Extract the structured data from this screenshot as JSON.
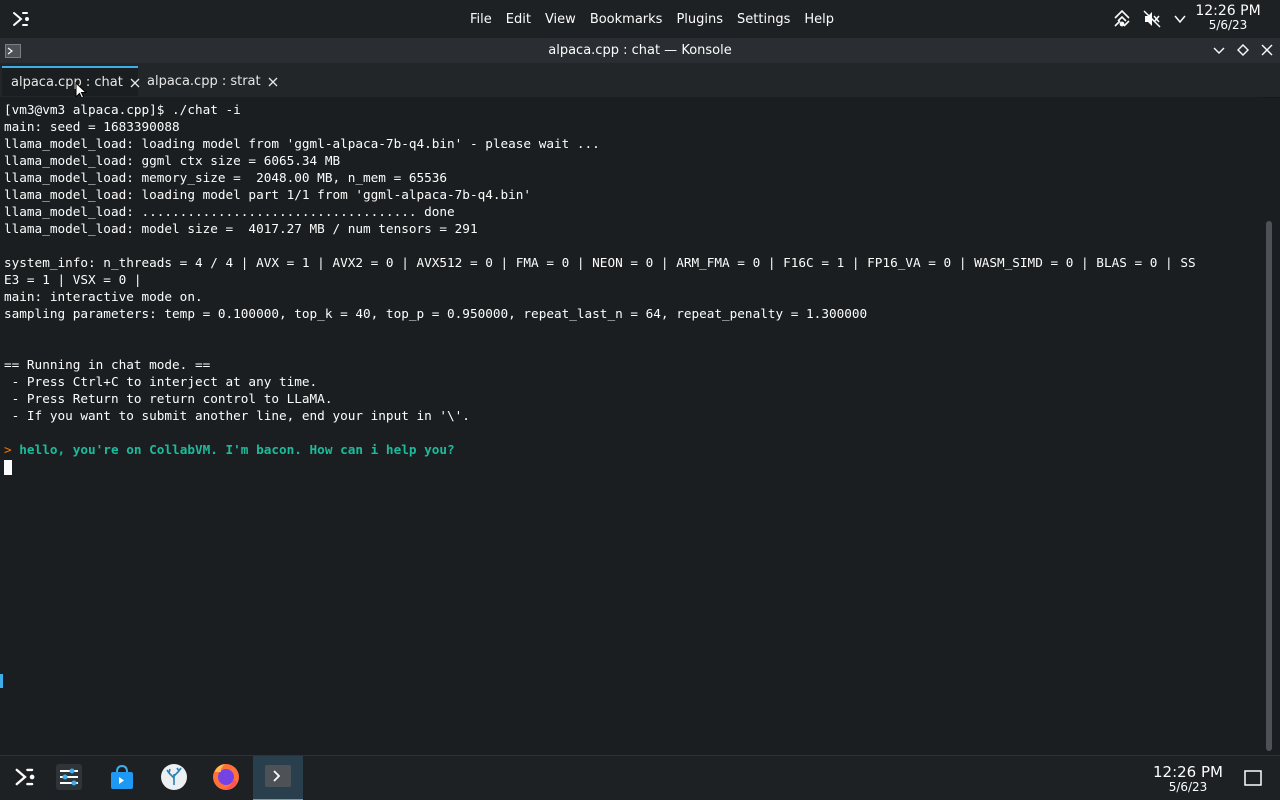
{
  "top_panel": {
    "menu": [
      "File",
      "Edit",
      "View",
      "Bookmarks",
      "Plugins",
      "Settings",
      "Help"
    ],
    "clock": {
      "time": "12:26 PM",
      "date": "5/6/23"
    },
    "tray_icons": [
      "network-icon",
      "volume-muted-icon",
      "chevron-down-icon"
    ]
  },
  "window": {
    "title": "alpaca.cpp : chat — Konsole"
  },
  "tabs": [
    {
      "label": "alpaca.cpp : chat",
      "active": true
    },
    {
      "label": "alpaca.cpp : strat",
      "active": false
    }
  ],
  "terminal": {
    "lines": [
      "[vm3@vm3 alpaca.cpp]$ ./chat -i",
      "main: seed = 1683390088",
      "llama_model_load: loading model from 'ggml-alpaca-7b-q4.bin' - please wait ...",
      "llama_model_load: ggml ctx size = 6065.34 MB",
      "llama_model_load: memory_size =  2048.00 MB, n_mem = 65536",
      "llama_model_load: loading model part 1/1 from 'ggml-alpaca-7b-q4.bin'",
      "llama_model_load: .................................... done",
      "llama_model_load: model size =  4017.27 MB / num tensors = 291",
      "",
      "system_info: n_threads = 4 / 4 | AVX = 1 | AVX2 = 0 | AVX512 = 0 | FMA = 0 | NEON = 0 | ARM_FMA = 0 | F16C = 1 | FP16_VA = 0 | WASM_SIMD = 0 | BLAS = 0 | SS",
      "E3 = 1 | VSX = 0 |",
      "main: interactive mode on.",
      "sampling parameters: temp = 0.100000, top_k = 40, top_p = 0.950000, repeat_last_n = 64, repeat_penalty = 1.300000",
      "",
      "",
      "== Running in chat mode. ==",
      " - Press Ctrl+C to interject at any time.",
      " - Press Return to return control to LLaMA.",
      " - If you want to submit another line, end your input in '\\'.",
      ""
    ],
    "prompt_marker": ">",
    "user_input": "hello, you're on CollabVM. I'm bacon. How can i help you?"
  },
  "taskbar": {
    "apps": [
      "application-launcher-icon",
      "system-settings-icon",
      "discover-store-icon",
      "kde-connect-icon",
      "firefox-icon",
      "konsole-icon"
    ],
    "clock": {
      "time": "12:26 PM",
      "date": "5/6/23"
    }
  },
  "colors": {
    "accent": "#3daee9",
    "prompt": "#f67400",
    "user_input": "#1abc9c",
    "background": "#1b1e20"
  }
}
